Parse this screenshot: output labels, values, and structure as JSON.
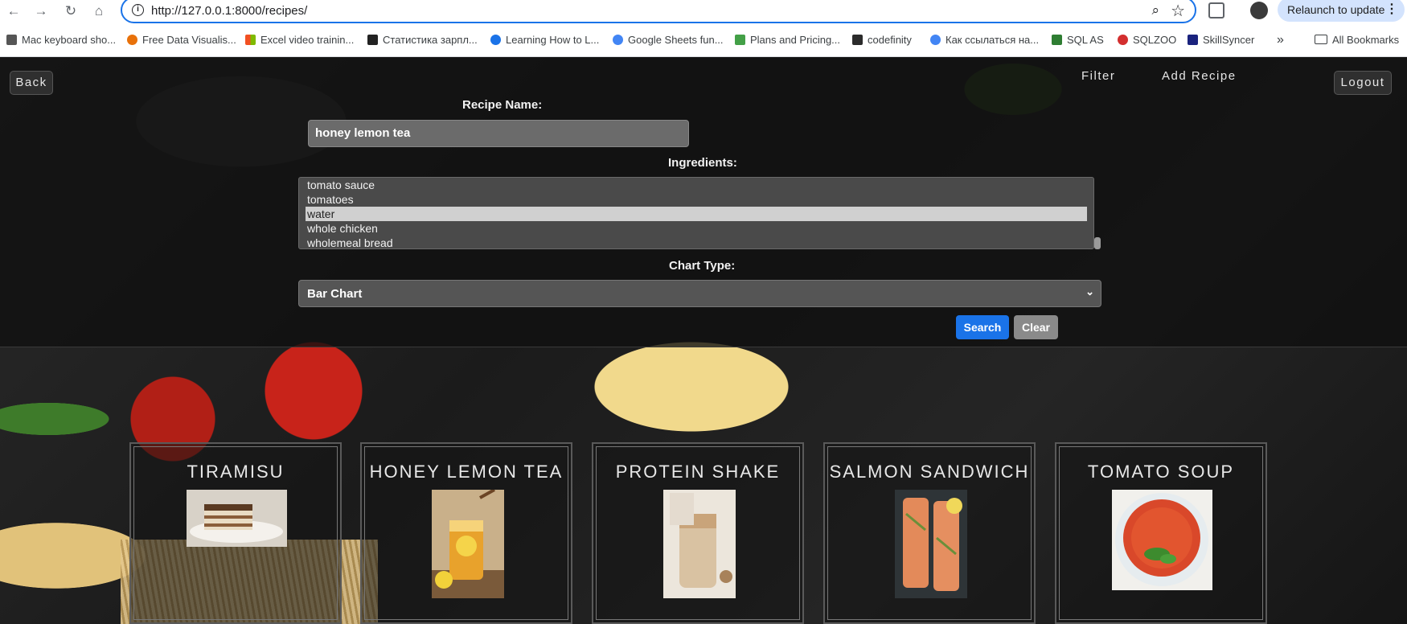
{
  "browser": {
    "url": "http://127.0.0.1:8000/recipes/",
    "relaunch_label": "Relaunch to update",
    "bookmarks": [
      {
        "label": "Mac keyboard sho...",
        "color": "#555555"
      },
      {
        "label": "Free Data Visualis...",
        "color": "#e8710a"
      },
      {
        "label": "Excel video trainin...",
        "color": "#0078d4"
      },
      {
        "label": "Статистика зарпл...",
        "color": "#222222"
      },
      {
        "label": "Learning How to L...",
        "color": "#1a73e8"
      },
      {
        "label": "Google Sheets fun...",
        "color": "#4285f4"
      },
      {
        "label": "Plans and Pricing...",
        "color": "#43a047"
      },
      {
        "label": "codefinity",
        "color": "#2b2b2b"
      },
      {
        "label": "Как ссылаться на...",
        "color": "#4285f4"
      },
      {
        "label": "SQL AS",
        "color": "#2e7d32"
      },
      {
        "label": "SQLZOO",
        "color": "#d32f2f"
      },
      {
        "label": "SkillSyncer",
        "color": "#1a237e"
      }
    ],
    "all_bookmarks_label": "All Bookmarks"
  },
  "header": {
    "back_label": "Back",
    "filter_label": "Filter",
    "add_recipe_label": "Add Recipe",
    "logout_label": "Logout"
  },
  "form": {
    "recipe_name_label": "Recipe Name:",
    "recipe_name_value": "honey lemon tea",
    "ingredients_label": "Ingredients:",
    "ingredients_visible": [
      "tomato sauce",
      "tomatoes",
      "water",
      "whole chicken",
      "wholemeal bread"
    ],
    "ingredients_selected": "water",
    "chart_type_label": "Chart Type:",
    "chart_type_value": "Bar Chart",
    "search_label": "Search",
    "clear_label": "Clear"
  },
  "recipes": [
    {
      "title": "TIRAMISU",
      "image_icon": "tiramisu-image"
    },
    {
      "title": "HONEY LEMON TEA",
      "image_icon": "honey-lemon-tea-image"
    },
    {
      "title": "PROTEIN SHAKE",
      "image_icon": "protein-shake-image"
    },
    {
      "title": "SALMON SANDWICH",
      "image_icon": "salmon-sandwich-image"
    },
    {
      "title": "TOMATO SOUP",
      "image_icon": "tomato-soup-image"
    }
  ],
  "colors": {
    "accent": "#1a73e8",
    "clear_button": "#8a8a8a"
  }
}
